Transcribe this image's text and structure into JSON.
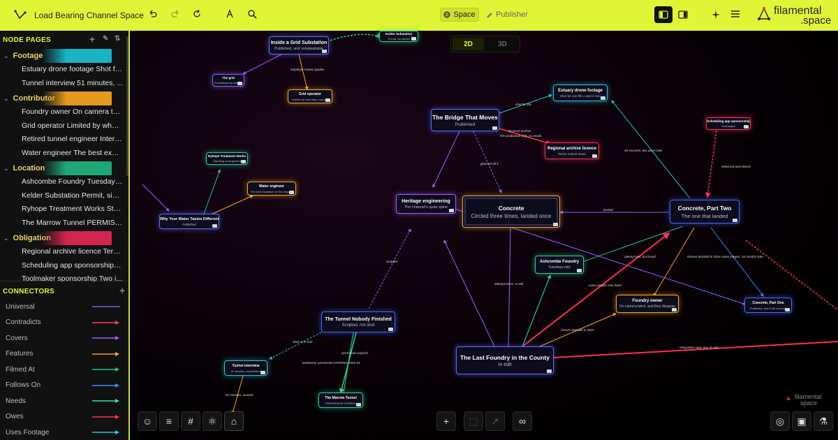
{
  "app": {
    "title": "Load Bearing Channel Space",
    "brand_line1": "filamental",
    "brand_line2": ".space",
    "accent": "#e0f536"
  },
  "topbar": {
    "undo_icon": "undo-icon",
    "redo_icon": "redo-icon",
    "refresh_icon": "refresh-icon",
    "tabs": [
      {
        "label": "Space",
        "active": true
      },
      {
        "label": "Publisher",
        "active": false
      }
    ]
  },
  "sidebar": {
    "node_pages_header": "NODE PAGES",
    "groups": [
      {
        "label": "Footage",
        "color": "#19b3c4",
        "items": [
          "Estuary drone footage Shot fo...",
          "Tunnel interview 51 minutes, ..."
        ]
      },
      {
        "label": "Contributor",
        "color": "#e39a1d",
        "items": [
          "Foundry owner On camera twi...",
          "Grid operator Limited by what ...",
          "Retired tunnel engineer Interv...",
          "Water engineer The best expl..."
        ]
      },
      {
        "label": "Location",
        "color": "#1fa877",
        "items": [
          "Ashcombe Foundry Tuesdays ...",
          "Kelder Substation Permit, six ...",
          "Ryhope Treatment Works Sta...",
          "The Marrow Tunnel PERMISSI..."
        ]
      },
      {
        "label": "Obligation",
        "color": "#d4254f",
        "items": [
          "Regional archive licence Term...",
          "Scheduling app sponsorship D...",
          "Toolmaker sponsorship Two i..."
        ]
      }
    ],
    "connectors_header": "CONNECTORS",
    "connectors": [
      {
        "label": "Universal",
        "color": "#6a6bd8",
        "arrow": false
      },
      {
        "label": "Contradicts",
        "color": "#ff3860",
        "arrow": true
      },
      {
        "label": "Covers",
        "color": "#a05cff",
        "arrow": true
      },
      {
        "label": "Features",
        "color": "#f5a623",
        "arrow": true
      },
      {
        "label": "Filmed At",
        "color": "#22c38e",
        "arrow": true
      },
      {
        "label": "Follows On",
        "color": "#3d8bff",
        "arrow": true
      },
      {
        "label": "Needs",
        "color": "#2ee59a",
        "arrow": true
      },
      {
        "label": "Owes",
        "color": "#ff2d55",
        "arrow": true
      },
      {
        "label": "Uses Footage",
        "color": "#26c6da",
        "arrow": true
      }
    ]
  },
  "view_toggle": {
    "options": [
      "2D",
      "3D"
    ],
    "active": "2D"
  },
  "nodes": [
    {
      "id": "substation",
      "title": "Inside a Grid Substation",
      "sub": "Published, and unrepeatable",
      "color": "#5a6cff"
    },
    {
      "id": "kelder",
      "title": "Kelder Substation",
      "sub": "Permit, six weeks",
      "color": "#2ccf8e"
    },
    {
      "id": "grid",
      "title": "The grid",
      "sub": "Constrained by window",
      "color": "#8e5cff"
    },
    {
      "id": "gridop",
      "title": "Grid operator",
      "sub": "Limited by what they may say",
      "color": "#f5a623"
    },
    {
      "id": "bridge",
      "title": "The Bridge That Moves",
      "sub": "Published",
      "color": "#5a6cff"
    },
    {
      "id": "estuary",
      "title": "Estuary drone footage",
      "sub": "Shot for one film, used in two",
      "color": "#26c6da"
    },
    {
      "id": "regional",
      "title": "Regional archive licence",
      "sub": "Terms restrict reuse",
      "color": "#ff2d55"
    },
    {
      "id": "schedapp",
      "title": "Scheduling app sponsorship",
      "sub": "Uncharged",
      "color": "#ff2d55"
    },
    {
      "id": "ryhope",
      "title": "Ryhope Treatment Works",
      "sub": "Standing arrangement",
      "color": "#2ccf8e"
    },
    {
      "id": "waterbody",
      "title": "Water engineer",
      "sub": "The best explainer on the channel",
      "color": "#f5a623"
    },
    {
      "id": "whywater",
      "title": "Why Your Water Tastes Different",
      "sub": "Published",
      "color": "#5a6cff"
    },
    {
      "id": "heritage",
      "title": "Heritage engineering",
      "sub": "The channel's quiet spine",
      "color": "#a05cff"
    },
    {
      "id": "concrete",
      "title": "Concrete",
      "sub": "Circled three times, landed once",
      "color": "#e8a23a"
    },
    {
      "id": "concrete2",
      "title": "Concrete, Part Two",
      "sub": "The one that landed",
      "color": "#3d6bff"
    },
    {
      "id": "ashcombe",
      "title": "Ashcombe Foundry",
      "sub": "Tuesdays only",
      "color": "#2ccf8e"
    },
    {
      "id": "foundryowner",
      "title": "Foundry owner",
      "sub": "On camera twice, and they disagree",
      "color": "#f5a623"
    },
    {
      "id": "concrete1",
      "title": "Concrete, Part One",
      "sub": "Published, and it did not work",
      "color": "#3d6bff"
    },
    {
      "id": "tunnel",
      "title": "The Tunnel Nobody Finished",
      "sub": "Scripted, not shot",
      "color": "#3d6bff"
    },
    {
      "id": "tunnelint",
      "title": "Tunnel interview",
      "sub": "51 minutes, unpublished",
      "color": "#26c6da"
    },
    {
      "id": "marrow",
      "title": "The Marrow Tunnel",
      "sub": "PERMISSION EXPIRED",
      "color": "#2ccf8e"
    },
    {
      "id": "lastfoundry",
      "title": "The Last Foundry in the County",
      "sub": "In edit",
      "color": "#5a6cff"
    }
  ],
  "edge_labels": [
    "shot for this",
    "licensed archive",
    "this production only, no resale",
    "40 seconds, two years later",
    "delivered and closed",
    "glanced off it",
    "employer review applies",
    "landed",
    "scripted",
    "attempt times, in edit",
    "same people, two dates",
    "attempt two, but broad",
    "closure decided in 2024",
    "same subject, 18 months later",
    "closure decided in 2023",
    "integration repo, due 31 Oct",
    "when it is shot",
    "permission expired",
    "landowner permission EXPIRED 2025-04",
    "51 minutes, unused"
  ],
  "watermark": {
    "line1": "filamental",
    "line2": "space"
  },
  "bottom_left_tools": [
    "mask-icon",
    "align-icon",
    "hash-icon",
    "atom-icon",
    "hat-icon"
  ],
  "bottom_center_tools": [
    "plus-icon",
    "frame-icon",
    "arrow-tool-icon",
    "link-icon"
  ],
  "bottom_right_tools": [
    "fingerprint-icon",
    "camera-icon",
    "flask-icon"
  ]
}
